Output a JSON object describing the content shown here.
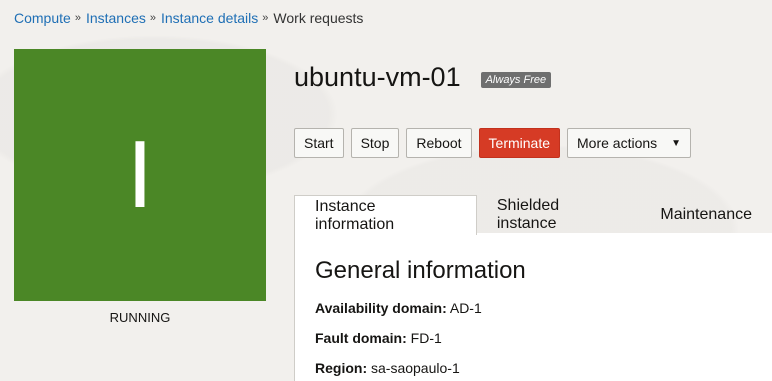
{
  "breadcrumb": [
    {
      "label": "Compute"
    },
    {
      "label": "Instances"
    },
    {
      "label": "Instance details"
    }
  ],
  "breadcrumb_current": "Work requests",
  "instance": {
    "initial": "I",
    "status": "RUNNING",
    "name": "ubuntu-vm-01",
    "tag": "Always Free",
    "badge_color": "#4b8726"
  },
  "actions": {
    "start": "Start",
    "stop": "Stop",
    "reboot": "Reboot",
    "terminate": "Terminate",
    "more": "More actions"
  },
  "tabs": [
    {
      "label": "Instance information",
      "active": true
    },
    {
      "label": "Shielded instance",
      "active": false
    },
    {
      "label": "Maintenance",
      "active": false
    }
  ],
  "general": {
    "title": "General information",
    "availability_domain_label": "Availability domain:",
    "availability_domain_value": "AD-1",
    "fault_domain_label": "Fault domain:",
    "fault_domain_value": "FD-1",
    "region_label": "Region:",
    "region_value": "sa-saopaulo-1"
  },
  "colors": {
    "accent": "#1f6fb5",
    "danger": "#d63b25"
  }
}
